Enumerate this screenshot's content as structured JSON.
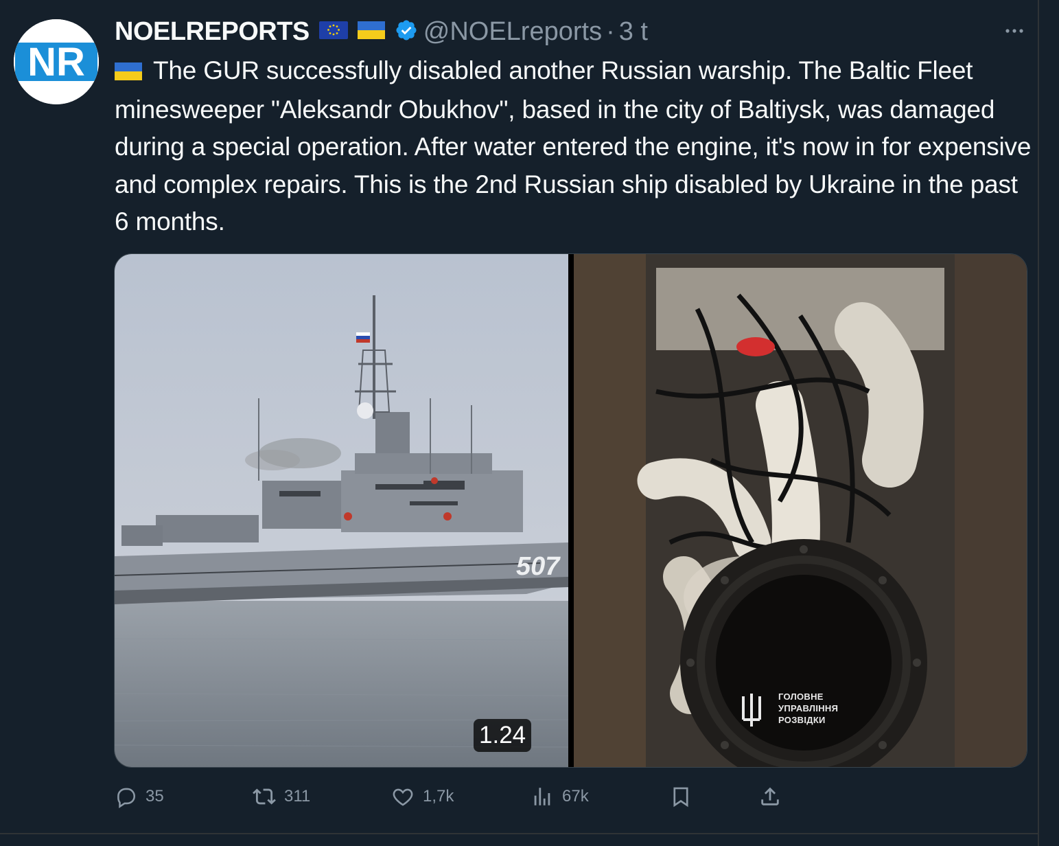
{
  "tweet": {
    "display_name": "NOELREPORTS",
    "handle": "@NOELreports",
    "separator": "·",
    "time": "3 t",
    "avatar_text": "NR",
    "text": "The GUR successfully disabled another Russian warship. The Baltic Fleet minesweeper \"Aleksandr Obukhov\", based in the city of Baltiysk, was damaged during a special operation. After water entered the engine, it's now in for expensive and complex repairs. This is the 2nd Russian ship disabled by Ukraine in the past 6 months.",
    "media": {
      "left_photo": {
        "hull_number": "507"
      },
      "right_video": {
        "duration": "1.24",
        "watermark": "ГОЛОВНЕ\nУПРАВЛІННЯ\nРОЗВІДКИ"
      }
    }
  },
  "actions": {
    "replies": "35",
    "reposts": "311",
    "likes": "1,7k",
    "views": "67k"
  },
  "colors": {
    "background": "#15202b",
    "secondary_text": "#8b98a5",
    "verified": "#1d9bf0",
    "avatar_brand": "#1b8fd8"
  },
  "icons": [
    "more-icon",
    "eu-flag-icon",
    "ukraine-flag-icon",
    "verified-badge-icon",
    "reply-icon",
    "repost-icon",
    "like-icon",
    "views-icon",
    "bookmark-icon",
    "share-icon"
  ]
}
